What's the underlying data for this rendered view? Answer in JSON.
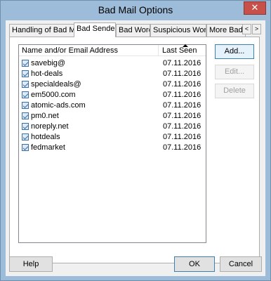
{
  "window": {
    "title": "Bad Mail Options",
    "close_glyph": "✕"
  },
  "tabs": [
    {
      "label": "Handling of Bad Mail",
      "active": false
    },
    {
      "label": "Bad Senders",
      "active": true
    },
    {
      "label": "Bad Words",
      "active": false
    },
    {
      "label": "Suspicious Words",
      "active": false
    },
    {
      "label": "More Bad Ch",
      "active": false
    }
  ],
  "tab_scroll": {
    "left": "<",
    "right": ">"
  },
  "list": {
    "columns": [
      "Name and/or Email Address",
      "Last Seen"
    ],
    "rows": [
      {
        "address": "savebig@",
        "last_seen": "07.11.2016"
      },
      {
        "address": "hot-deals",
        "last_seen": "07.11.2016"
      },
      {
        "address": "specialdeals@",
        "last_seen": "07.11.2016"
      },
      {
        "address": "em5000.com",
        "last_seen": "07.11.2016"
      },
      {
        "address": "atomic-ads.com",
        "last_seen": "07.11.2016"
      },
      {
        "address": "pm0.net",
        "last_seen": "07.11.2016"
      },
      {
        "address": "noreply.net",
        "last_seen": "07.11.2016"
      },
      {
        "address": "hotdeals",
        "last_seen": "07.11.2016"
      },
      {
        "address": "fedmarket",
        "last_seen": "07.11.2016"
      }
    ]
  },
  "side_buttons": {
    "add": "Add...",
    "edit": "Edit...",
    "delete": "Delete"
  },
  "footer": {
    "help": "Help",
    "ok": "OK",
    "cancel": "Cancel"
  },
  "colors": {
    "frame": "#9dbcd9",
    "client": "#f0f0f0",
    "accent": "#3c7fb1"
  }
}
